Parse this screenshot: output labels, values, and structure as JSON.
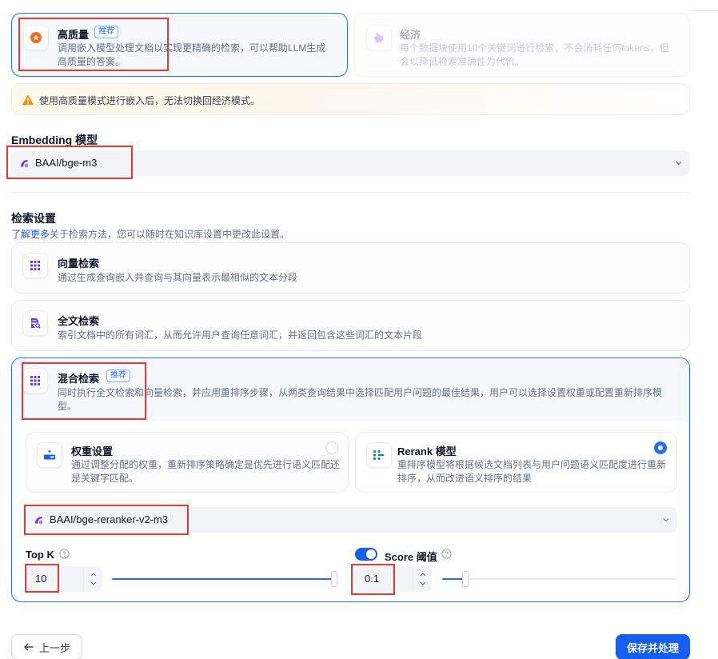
{
  "index_mode": {
    "high_quality": {
      "title": "高质量",
      "badge": "推荐",
      "desc": "调用嵌入模型处理文档以实现更精确的检索，可以帮助LLM生成高质量的答案。"
    },
    "economy": {
      "title": "经济",
      "desc": "每个数据块使用10个关键词进行检索，不会消耗任何tokens，但会以降低检索准确性为代价。"
    },
    "warning": "使用高质量模式进行嵌入后，无法切换回经济模式。"
  },
  "embedding": {
    "label": "Embedding 模型",
    "selected": "BAAI/bge-m3"
  },
  "retrieval": {
    "title": "检索设置",
    "learn_more": "了解更多",
    "subtitle": "关于检索方法，您可以随时在知识库设置中更改此设置。",
    "vector": {
      "title": "向量检索",
      "desc": "通过生成查询嵌入并查询与其向量表示最相似的文本分段"
    },
    "fulltext": {
      "title": "全文检索",
      "desc": "索引文档中的所有词汇，从而允许用户查询任意词汇，并返回包含这些词汇的文本片段"
    },
    "hybrid": {
      "title": "混合检索",
      "badge": "推荐",
      "desc": "同时执行全文检索和向量检索，并应用重排序步骤，从两类查询结果中选择匹配用户问题的最佳结果，用户可以选择设置权重或配置重新排序模型。",
      "weight": {
        "title": "权重设置",
        "desc": "通过调整分配的权重，重新排序策略确定是优先进行语义匹配还是关键字匹配。"
      },
      "rerank": {
        "title": "Rerank 模型",
        "desc": "重排序模型将根据候选文档列表与用户问题语义匹配度进行重新排序，从而改进语义排序的结果"
      },
      "rerank_model": "BAAI/bge-reranker-v2-m3",
      "topk": {
        "label": "Top K",
        "value": "10",
        "level": 1.0
      },
      "score": {
        "label": "Score 阈值",
        "value": "0.1",
        "level": 0.1
      }
    }
  },
  "footer": {
    "prev": "上一步",
    "save": "保存并处理"
  }
}
